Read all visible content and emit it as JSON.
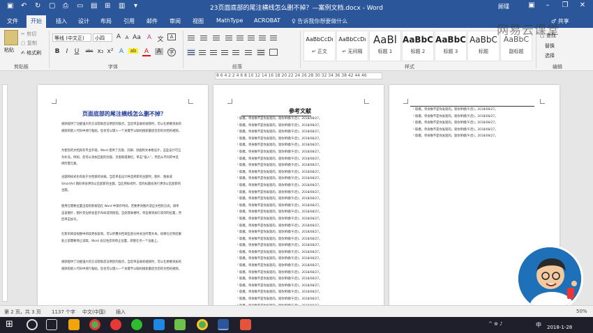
{
  "window": {
    "title": "23页面底部的尾注横线怎么删不掉？—案例文档.docx  -  Word",
    "user": "顾瑾",
    "controls": [
      "restore",
      "minimize",
      "maximize",
      "close"
    ]
  },
  "tabs": [
    "文件",
    "开始",
    "插入",
    "设计",
    "布局",
    "引用",
    "邮件",
    "审阅",
    "视图",
    "MathType",
    "ACROBAT"
  ],
  "active_tab": "开始",
  "tell_me": "♀ 告诉我你想要做什么",
  "share": "♂ 共享",
  "ribbon": {
    "clipboard": {
      "paste": "粘贴",
      "cut": "✂ 剪切",
      "copy": "▢ 复制",
      "format_painter": "✍ 格式刷",
      "group": "剪贴板"
    },
    "font": {
      "name": "等线 (中文正)",
      "size": "小四",
      "grow": "A",
      "shrink": "A",
      "aa": "Aa",
      "clear": "A",
      "pinyin": "文",
      "border": "A",
      "bold": "B",
      "italic": "I",
      "underline": "U",
      "strike": "abc",
      "sub": "x₂",
      "sup": "x²",
      "effects": "A",
      "highlight": "ab",
      "color": "A",
      "shade": "A",
      "circle": "字",
      "group": "字体"
    },
    "paragraph": {
      "group": "段落"
    },
    "styles": {
      "items": [
        {
          "preview": "AaBbCcDı",
          "name": "↵ 正文"
        },
        {
          "preview": "AaBbCcDı",
          "name": "↵ 无间隔"
        },
        {
          "preview": "AaBl",
          "name": "标题 1"
        },
        {
          "preview": "AaBbC",
          "name": "标题 2"
        },
        {
          "preview": "AaBbC",
          "name": "标题 3"
        },
        {
          "preview": "AaBbC",
          "name": "标题"
        },
        {
          "preview": "AaBbC",
          "name": "副标题"
        }
      ],
      "group": "样式"
    },
    "editing": {
      "find": "▢ 查找",
      "replace": "替换",
      "select": "选择",
      "group": "编辑"
    }
  },
  "watermark": "网易云课堂",
  "ruler": "8  6  4  2     2  4  6  8  10  12  14  16  18  20  22  24  26  28  30  32  34  36  38     42  44  46",
  "page1": {
    "title": "页面底部的尾注横线怎么删不掉？",
    "paragraphs": [
      "视频提供了功能强大的方法帮助您证明您的观点。当您单击联机视频时，可以在想要添加的视频的嵌入代码中进行粘贴。您也可以键入一个关键字以联机搜索最适合您的文档的视频。",
      "为使您的文档具有专业外观，Word 提供了页眉、页脚、封面和文本框设计，这些设计可互为补充。例如，您可以添加匹配的封面、页眉和提要栏。单击“插入”，然后从不同库中选择所需元素。",
      "主题和样式也有助于文档保持协调。当您单击设计并选择新的主题时，图片、图表或 SmartArt 图形将会更改以匹配新的主题。当应用样式时，您的标题会进行更改以匹配新的主题。",
      "使用在需要位置出现的新按钮在 Word 中保存时间。若要更改图片适应文档的方式，请单击该图片，图片旁边将会显示布局选项按钮。当处理表格时，单击要添加行或列的位置，然后单击加号。",
      "在新的阅读视图中阅读更加容易。可以折叠文档某些部分并关注所需文本。如果在达到结尾处之前需要停止读取，Word 会记住您的停止位置，即使在另一个设备上。",
      "视频提供了功能强大的方法帮助您证明您的观点。当您单击联机视频时，可以在想要添加的视频的嵌入代码中进行粘贴。您也可以键入一个关键字以联机搜索最适合您的文档的视频。"
    ]
  },
  "page2": {
    "title": "参考文献",
    "ref_text": "¹ 取模，单身数不是你发现的，现你单模(午后)，2018/08/27。",
    "ref_count": 30
  },
  "page3": {
    "ref_text": "¹ 取模，单身数不是你发现的，现你单模(午后)，2018/08/27。",
    "ref_count": 5
  },
  "status": {
    "page": "第 2 页，共 3 页",
    "words": "1137 个字",
    "language": "中文(中国)",
    "mode": "插入",
    "zoom": "50%"
  },
  "taskbar": {
    "time": "",
    "date": "2018-1-28",
    "ime": "中",
    "tray": "^  ⊕  ♪"
  },
  "colors": {
    "titlebar": "#2b579a",
    "heading": "#1f3a9a",
    "taskbar": "#1f1f2b"
  }
}
